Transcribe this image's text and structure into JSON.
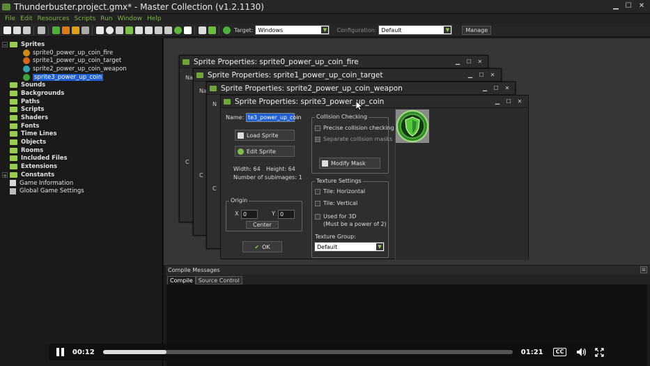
{
  "window": {
    "title": "Thunderbuster.project.gmx*  -  Master Collection (v1.2.1130)"
  },
  "menu": [
    "File",
    "Edit",
    "Resources",
    "Scripts",
    "Run",
    "Window",
    "Help"
  ],
  "toolbar": {
    "target_label": "Target:",
    "target_value": "Windows",
    "config_label": "Configuration:",
    "config_value": "Default",
    "manage_label": "Manage"
  },
  "tree": {
    "sprites_label": "Sprites",
    "sprites": [
      "sprite0_power_up_coin_fire",
      "sprite1_power_up_coin_target",
      "sprite2_power_up_coin_weapon",
      "sprite3_power_up_coin"
    ],
    "folders": [
      "Sounds",
      "Backgrounds",
      "Paths",
      "Scripts",
      "Shaders",
      "Fonts",
      "Time Lines",
      "Objects",
      "Rooms",
      "Included Files",
      "Extensions",
      "Constants"
    ],
    "game_information": "Game Information",
    "global_settings": "Global Game Settings"
  },
  "windows": {
    "w0_title": "Sprite Properties: sprite0_power_up_coin_fire",
    "w1_title": "Sprite Properties: sprite1_power_up_coin_target",
    "w2_title": "Sprite Properties: sprite2_power_up_coin_weapon",
    "w3_title": "Sprite Properties: sprite3_power_up_coin",
    "stub_na": "Na",
    "stub_n": "N",
    "stub_c": "C"
  },
  "sprite_props": {
    "name_label": "Name:",
    "name_value": "te3_power_up_coin",
    "load_sprite": "Load Sprite",
    "edit_sprite": "Edit Sprite",
    "width": "Width: 64",
    "height": "Height: 64",
    "subimages": "Number of subimages: 1",
    "origin_label": "Origin",
    "x_label": "X",
    "x_value": "0",
    "y_label": "Y",
    "y_value": "0",
    "center_label": "Center",
    "ok_label": "OK",
    "collision_label": "Collision Checking",
    "precise_label": "Precise collision checking",
    "separate_label": "Separate collision masks",
    "modify_mask": "Modify Mask",
    "texture_label": "Texture Settings",
    "tile_h": "Tile: Horizontal",
    "tile_v": "Tile: Vertical",
    "used_3d": "Used for 3D",
    "power_of_2": "(Must be a power of 2)",
    "texture_group_label": "Texture Group:",
    "texture_group_value": "Default"
  },
  "compile": {
    "header": "Compile Messages",
    "tabs": [
      "Compile",
      "Source Control"
    ]
  },
  "video": {
    "elapsed": "00:12",
    "duration": "01:21",
    "progress": 0.155,
    "cc_label": "CC"
  },
  "colors": {
    "accent_green": "#7fb24a",
    "folder_green": "#9acb52",
    "selection_blue": "#1f5fd0",
    "coin_green": "#3fa33a"
  }
}
